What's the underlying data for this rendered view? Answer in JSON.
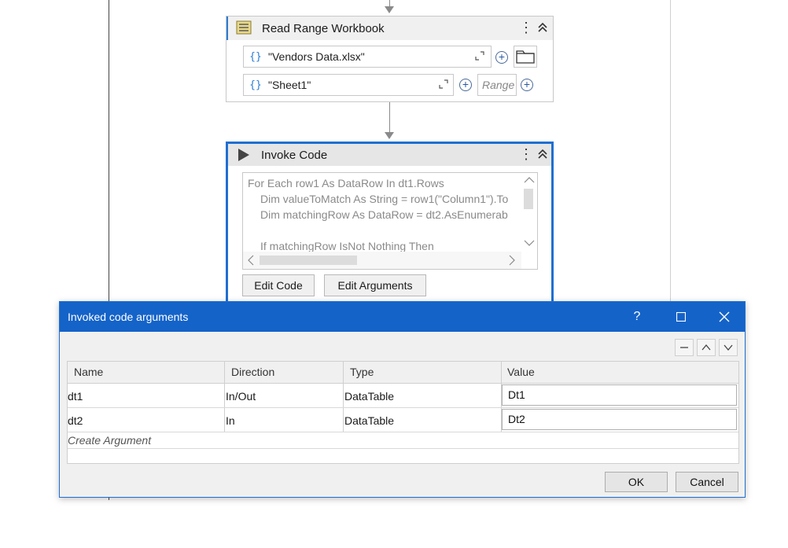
{
  "read_range": {
    "title": "Read Range Workbook",
    "workbook_path": "\"Vendors Data.xlsx\"",
    "sheet_name": "\"Sheet1\"",
    "range_placeholder": "Range"
  },
  "invoke_code": {
    "title": "Invoke Code",
    "code_lines": [
      "For Each row1 As DataRow In dt1.Rows",
      "Dim valueToMatch As String = row1(\"Column1\").To",
      "Dim matchingRow As DataRow = dt2.AsEnumerab",
      "",
      "If matchingRow IsNot Nothing Then"
    ],
    "edit_code_label": "Edit Code",
    "edit_arguments_label": "Edit Arguments"
  },
  "dialog": {
    "title": "Invoked code arguments",
    "help": "?",
    "columns": [
      "Name",
      "Direction",
      "Type",
      "Value"
    ],
    "rows": [
      {
        "name": "dt1",
        "direction": "In/Out",
        "type": "DataTable",
        "value": "Dt1"
      },
      {
        "name": "dt2",
        "direction": "In",
        "type": "DataTable",
        "value": "Dt2"
      }
    ],
    "create_argument": "Create Argument",
    "ok_label": "OK",
    "cancel_label": "Cancel"
  }
}
